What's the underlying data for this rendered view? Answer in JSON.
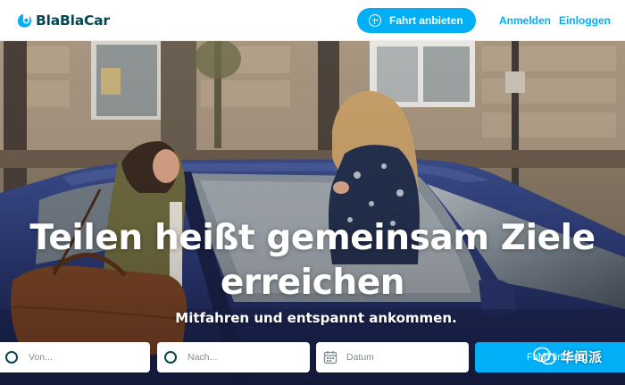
{
  "header": {
    "logo_text": "BlaBlaCar",
    "offer_ride_label": "Fahrt anbieten",
    "register_label": "Anmelden",
    "login_label": "Einloggen"
  },
  "hero": {
    "title_line1": "Teilen heißt gemeinsam Ziele",
    "title_line2": "erreichen",
    "subtitle": "Mitfahren und entspannt ankommen."
  },
  "search": {
    "from_placeholder": "Von...",
    "to_placeholder": "Nach...",
    "date_placeholder": "Datum",
    "button_label": "Fahrt finden"
  },
  "watermark": {
    "text": "华闻派"
  },
  "icons": {
    "offer_ride": "plus-circle-icon",
    "from": "ring-icon",
    "to": "ring-icon",
    "date": "calendar-icon"
  },
  "colors": {
    "brand_blue": "#00aff5",
    "brand_dark": "#054752",
    "placeholder_gray": "#7f8c91",
    "car_blue": "#26356f"
  }
}
